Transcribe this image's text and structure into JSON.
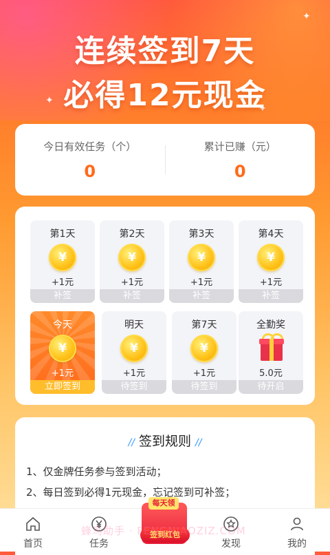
{
  "hero": {
    "line1": "连续签到7天",
    "line2": "必得12元现金"
  },
  "stats": [
    {
      "label": "今日有效任务（个）",
      "value": "0"
    },
    {
      "label": "累计已赚（元）",
      "value": "0"
    }
  ],
  "days": [
    {
      "title": "第1天",
      "reward": "+1元",
      "status": "补签"
    },
    {
      "title": "第2天",
      "reward": "+1元",
      "status": "补签"
    },
    {
      "title": "第3天",
      "reward": "+1元",
      "status": "补签"
    },
    {
      "title": "第4天",
      "reward": "+1元",
      "status": "补签"
    },
    {
      "title": "今天",
      "reward": "+1元",
      "status": "立即签到"
    },
    {
      "title": "明天",
      "reward": "+1元",
      "status": "待签到"
    },
    {
      "title": "第7天",
      "reward": "+1元",
      "status": "待签到"
    },
    {
      "title": "全勤奖",
      "reward": "5.0元",
      "status": "待开启"
    }
  ],
  "coin_symbol": "¥",
  "rules": {
    "title": "签到规则",
    "items": [
      "1、仅金牌任务参与签到活动；",
      "2、每日签到必得1元现金，忘记签到可补签；"
    ]
  },
  "tabbar": {
    "items": [
      {
        "label": "首页",
        "icon": "home-icon"
      },
      {
        "label": "任务",
        "icon": "yuan-icon"
      },
      {
        "label": "发现",
        "icon": "star-icon"
      },
      {
        "label": "我的",
        "icon": "user-icon"
      }
    ],
    "center": {
      "top": "每天领",
      "bottom": "签到红包"
    }
  },
  "watermark": "蜂鸟助手 · FENGNIAOZIZ.COM",
  "colors": {
    "accent": "#ff6a1a",
    "coin": "#ffc21a",
    "today": "#ff7a24"
  }
}
